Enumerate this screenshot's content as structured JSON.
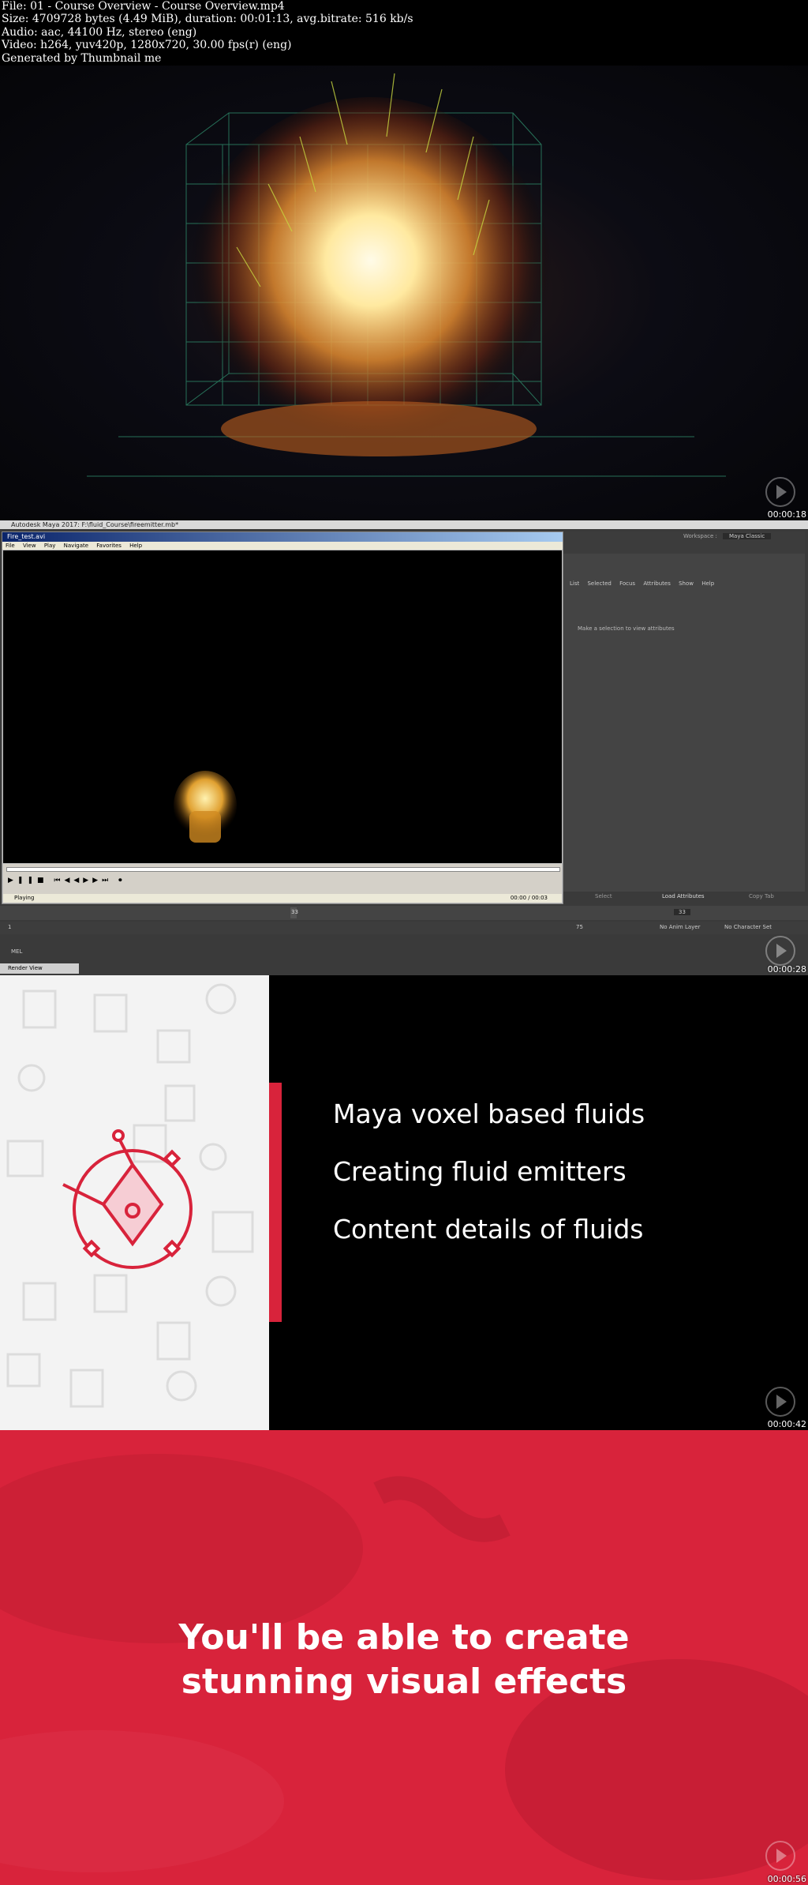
{
  "header": {
    "lines": [
      "File: 01 - Course Overview - Course Overview.mp4",
      "Size: 4709728 bytes (4.49 MiB), duration: 00:01:13, avg.bitrate: 516 kb/s",
      "Audio: aac, 44100 Hz, stereo (eng)",
      "Video: h264, yuv420p, 1280x720, 30.00 fps(r) (eng)",
      "Generated by Thumbnail me"
    ]
  },
  "frames": [
    {
      "timestamp": "00:00:18"
    },
    {
      "timestamp": "00:00:28"
    },
    {
      "timestamp": "00:00:42"
    },
    {
      "timestamp": "00:00:56"
    }
  ],
  "maya": {
    "window_title": "Autodesk Maya 2017: F:\\fluid_Course\\fireemitter.mb*",
    "fcheck_title": "Fire_test.avi",
    "fcheck_menu": [
      "File",
      "View",
      "Play",
      "Navigate",
      "Favorites",
      "Help"
    ],
    "status_left": "Playing",
    "status_right": "00:00 / 00:03",
    "workspace_label": "Workspace :",
    "workspace_value": "Maya Classic",
    "attr_menu": [
      "List",
      "Selected",
      "Focus",
      "Attributes",
      "Show",
      "Help"
    ],
    "attr_message": "Make a selection to view attributes",
    "attr_buttons": [
      "Select",
      "Load Attributes",
      "Copy Tab"
    ],
    "current_frame": "33",
    "range_start": "1",
    "range_end": "75",
    "anim_layer": "No Anim Layer",
    "char_set": "No Character Set",
    "mel_label": "MEL",
    "taskbar_label": "Render View"
  },
  "slide": {
    "bullets": [
      "Maya voxel based fluids",
      "Creating fluid emitters",
      "Content details of fluids"
    ]
  },
  "end": {
    "line1": "You'll be able to create",
    "line2": "stunning visual effects"
  },
  "colors": {
    "brand_red": "#d8233b",
    "maya_gray": "#444444"
  }
}
